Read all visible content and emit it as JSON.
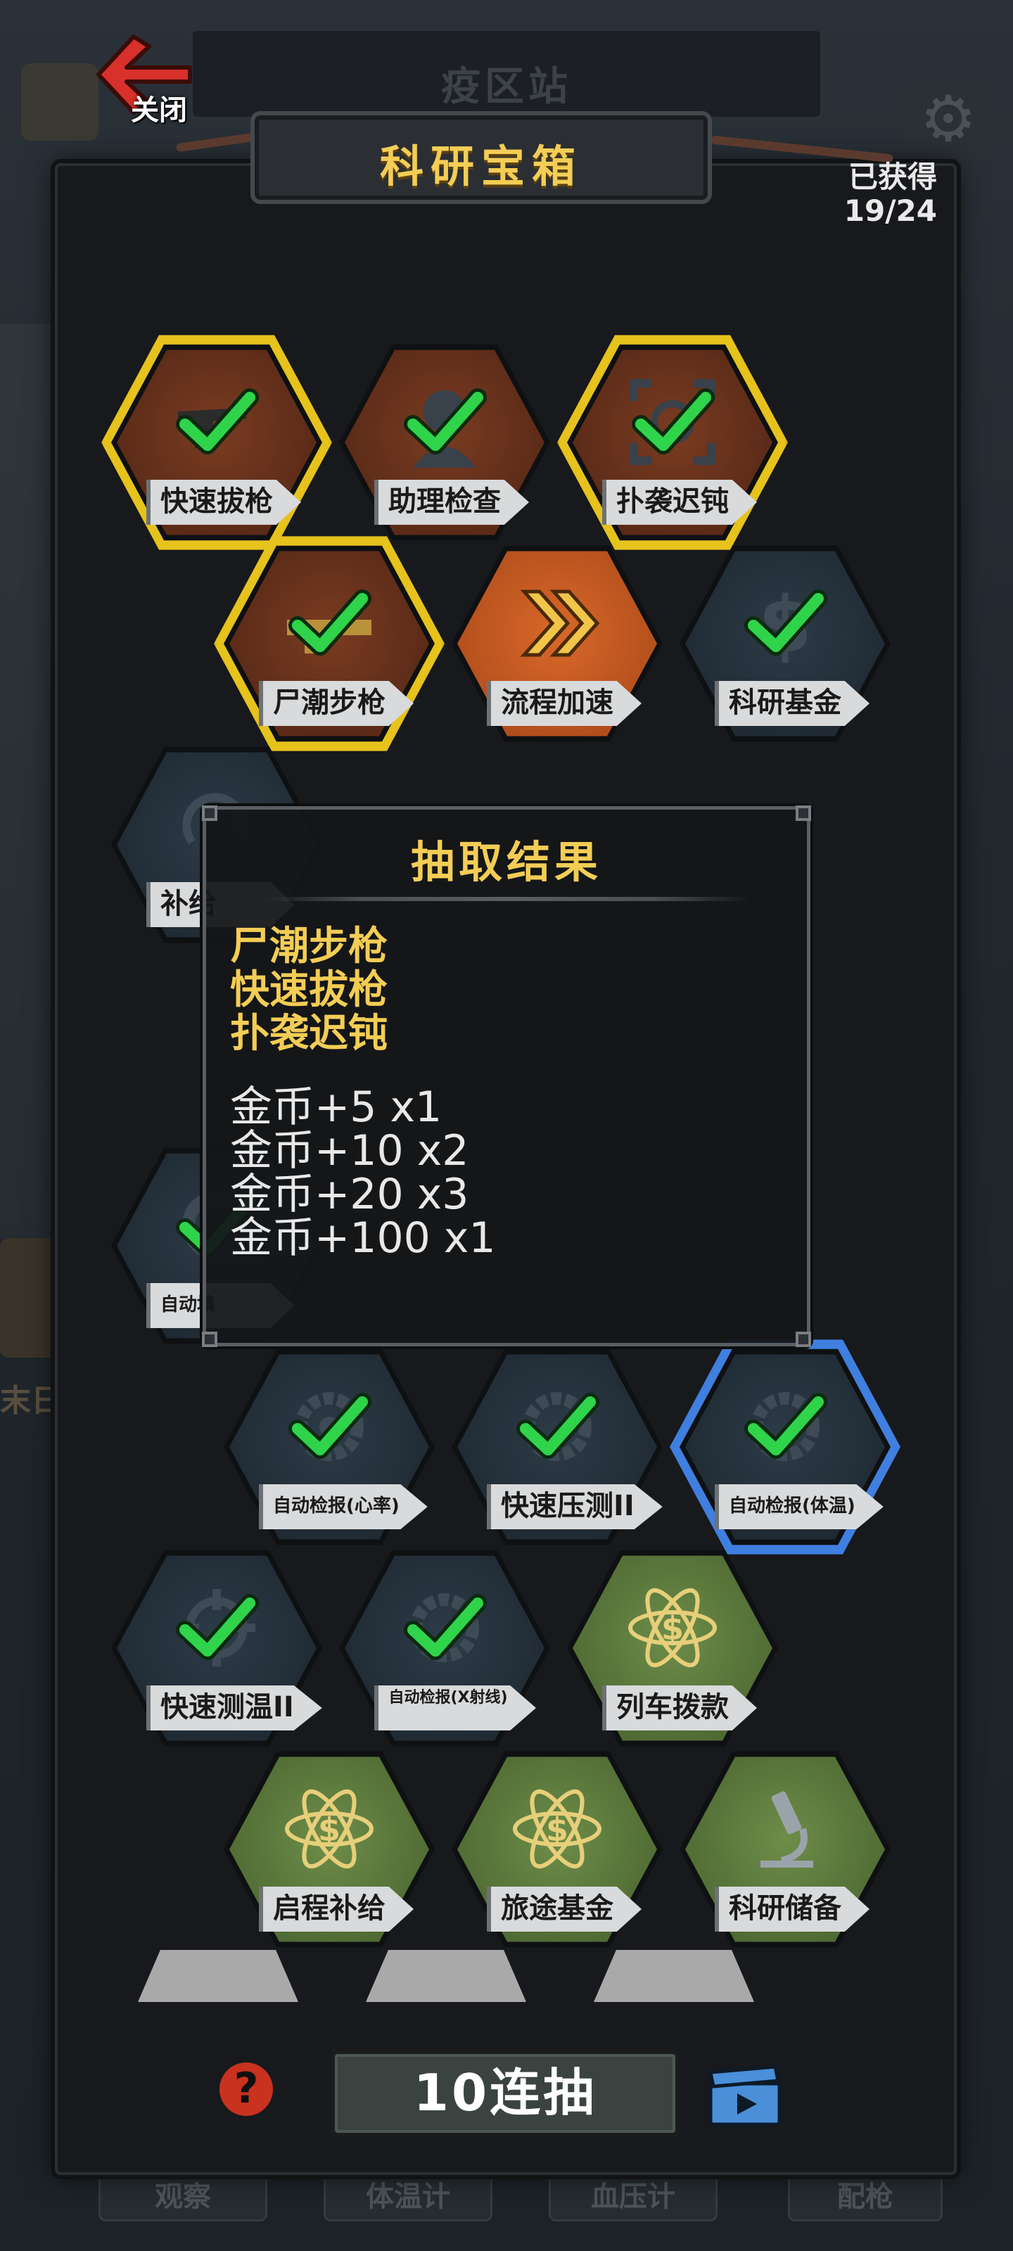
{
  "background": {
    "station_title": "疫区站",
    "bottom_tabs": [
      "观察",
      "体温计",
      "血压计",
      "配枪"
    ],
    "side_text": "末日"
  },
  "header": {
    "close_label": "关闭",
    "title": "科研宝箱",
    "obtained_label": "已获得",
    "obtained_count": "19/24"
  },
  "tiles": [
    {
      "label": "快速拔枪",
      "style": "brown",
      "glow": "gold",
      "icon": "revolver-icon",
      "checked": true
    },
    {
      "label": "助理检查",
      "style": "brown",
      "glow": "",
      "icon": "assistant-icon",
      "checked": true
    },
    {
      "label": "扑袭迟钝",
      "style": "brown",
      "glow": "gold",
      "icon": "target-frame-icon",
      "checked": true
    },
    {
      "label": "尸潮步枪",
      "style": "brown",
      "glow": "gold",
      "icon": "rifle-icon",
      "checked": true
    },
    {
      "label": "流程加速",
      "style": "orange",
      "glow": "",
      "icon": "fast-forward-icon",
      "checked": false
    },
    {
      "label": "科研基金",
      "style": "slate",
      "glow": "",
      "icon": "dollar-icon",
      "checked": true
    },
    {
      "label": "补给",
      "style": "slate",
      "glow": "",
      "icon": "refresh-icon",
      "checked": false
    },
    {
      "label": "自动填",
      "style": "slate",
      "glow": "",
      "icon": "gear-icon",
      "checked": true
    },
    {
      "label": "自动检报(心率)",
      "style": "slate",
      "glow": "",
      "icon": "gear-icon",
      "checked": true
    },
    {
      "label": "快速压测II",
      "style": "slate",
      "glow": "",
      "icon": "gear-icon",
      "checked": true
    },
    {
      "label": "自动检报(体温)",
      "style": "slate",
      "glow": "blue",
      "icon": "gear-icon",
      "checked": true
    },
    {
      "label": "快速测温II",
      "style": "slate",
      "glow": "",
      "icon": "target-icon",
      "checked": true
    },
    {
      "label": "自动检报(X射线)",
      "style": "slate",
      "glow": "",
      "icon": "gear-icon",
      "checked": true
    },
    {
      "label": "列车拨款",
      "style": "green",
      "glow": "",
      "icon": "atom-dollar-icon",
      "checked": false
    },
    {
      "label": "启程补给",
      "style": "green",
      "glow": "",
      "icon": "atom-dollar-icon",
      "checked": false
    },
    {
      "label": "旅途基金",
      "style": "green",
      "glow": "",
      "icon": "atom-dollar-icon",
      "checked": false
    },
    {
      "label": "科研储备",
      "style": "green",
      "glow": "",
      "icon": "microscope-icon",
      "checked": false
    }
  ],
  "result_dialog": {
    "title": "抽取结果",
    "items": [
      "尸潮步枪",
      "快速拔枪",
      "扑袭迟钝"
    ],
    "rewards": [
      "金币+5 x1",
      "金币+10 x2",
      "金币+20 x3",
      "金币+100 x1"
    ]
  },
  "footer": {
    "help_label": "?",
    "draw_label": "10连抽"
  },
  "colors": {
    "gold": "#f3cd55",
    "brown_tile": "#6b3320",
    "orange_tile": "#d0602a",
    "slate_tile": "#26323d",
    "green_tile": "#5e7b3f",
    "check_green": "#2fd44b",
    "blue_glow": "#3f7fe0"
  }
}
